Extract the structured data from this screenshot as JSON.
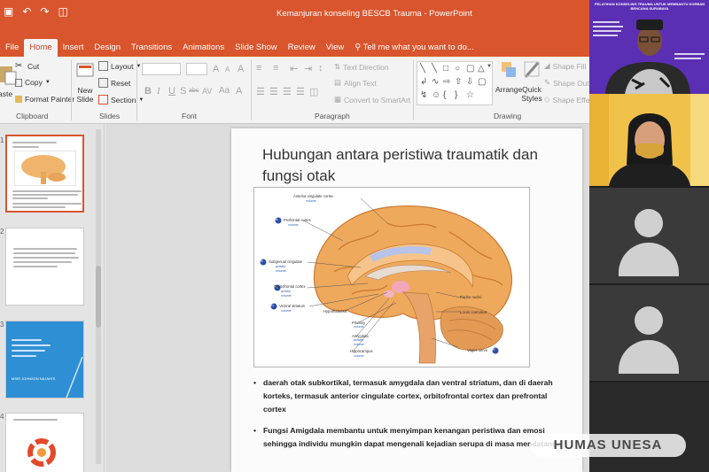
{
  "window": {
    "title": "Kemanjuran konseling BESCB Trauma - PowerPoint",
    "accent_color": "#d9552d"
  },
  "menu": {
    "tabs": [
      "File",
      "Home",
      "Insert",
      "Design",
      "Transitions",
      "Animations",
      "Slide Show",
      "Review",
      "View"
    ],
    "active_tab": "Home",
    "tell_me": "Tell me what you want to do..."
  },
  "ribbon": {
    "clipboard": {
      "paste": "aste",
      "cut": "Cut",
      "copy": "Copy",
      "format_painter": "Format Painter",
      "label": "Clipboard"
    },
    "slides": {
      "new_slide": "New Slide",
      "layout": "Layout",
      "reset": "Reset",
      "section": "Section",
      "label": "Slides"
    },
    "font": {
      "bold": "B",
      "italic": "I",
      "underline": "U",
      "strike": "S",
      "shadow": "abc",
      "spacing": "AV",
      "case": "Aa",
      "color": "A",
      "grow": "A",
      "shrink": "A",
      "clear": "A",
      "label": "Font"
    },
    "paragraph": {
      "text_direction": "Text Direction",
      "align_text": "Align Text",
      "convert_smartart": "Convert to SmartArt",
      "label": "Paragraph"
    },
    "drawing": {
      "arrange": "Arrange",
      "quick_styles": "Quick Styles",
      "shape_fill": "Shape Fill",
      "shape_outline": "Shape Outl",
      "shape_effects": "Shape Effe",
      "label": "Drawing"
    }
  },
  "thumbnails": {
    "numbers": [
      "1",
      "2",
      "3",
      "4"
    ],
    "slide3_text": "MSIR JOHNSON NAJAHI'S"
  },
  "slide": {
    "title": "Hubungan antara peristiwa traumatik dan fungsi otak",
    "brain_labels": {
      "acc": "Anterior cingulate cortex",
      "prefrontal": "Prefrontal cortex",
      "subgenual": "Subgenual cingulate",
      "orbitofrontal": "Orbitofrontal cortex",
      "ventral": "Ventral striatum",
      "hypothalamus": "Hypothalamus",
      "pituitary": "Pituitary",
      "amygdala": "Amygdala",
      "hippocampus": "Hippocampus",
      "raphe": "Raphe nuclei",
      "locus": "Locus coeruleus",
      "vagus": "Vagus nerve",
      "activity": "activity",
      "volume": "volume",
      "marker_a": "A",
      "marker_b": "B",
      "marker_c": "C",
      "marker_d": "D",
      "marker_e": "E"
    },
    "bullets": [
      "daerah otak subkortikal, termasuk amygdala dan ventral striatum, dan di daerah korteks, termasuk anterior cingulate cortex,  orbitofrontal cortex dan prefrontal cortex",
      "Fungsi Amigdala membantu untuk menyimpan kenangan peristiwa dan emosi sehingga individu mungkin dapat mengenali kejadian serupa di masa mendatang."
    ]
  },
  "video": {
    "banner_title": "PELATIHAN KONSELING TRAUMA UNTUK MEMBANTU KORBAN BENCANA SURABAYA",
    "banner_color": "#5b2fb3"
  },
  "watermark": "HUMAS UNESA"
}
